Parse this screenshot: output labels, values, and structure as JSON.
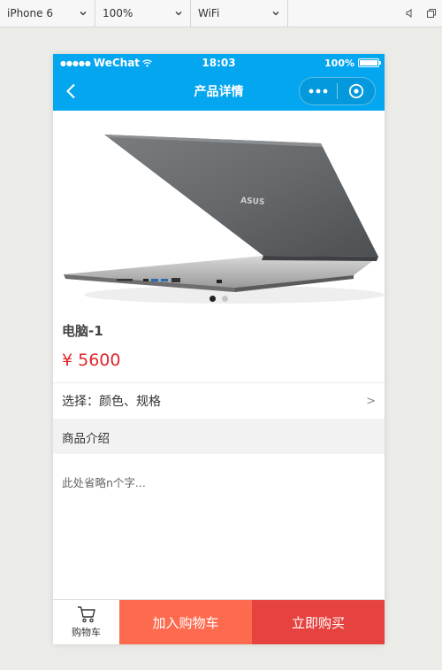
{
  "simulator": {
    "device": "iPhone 6",
    "zoom": "100%",
    "network": "WiFi"
  },
  "status_bar": {
    "carrier": "WeChat",
    "time": "18:03",
    "battery": "100%",
    "battery_level": 1.0
  },
  "nav": {
    "title": "产品详情"
  },
  "carousel": {
    "slide_count": 2,
    "active_index": 0,
    "brand_text": "ASUS"
  },
  "product": {
    "name": "电脑-1",
    "price": "¥ 5600"
  },
  "spec": {
    "label": "选择：颜色、规格",
    "arrow": ">"
  },
  "intro": {
    "header": "商品介绍",
    "text": "此处省略n个字..."
  },
  "bottom_bar": {
    "cart_label": "购物车",
    "add_to_cart": "加入购物车",
    "buy_now": "立即购买"
  },
  "colors": {
    "nav_blue": "#04a6ef",
    "price_red": "#e0252c",
    "add_cart_orange": "#fd6a4e",
    "buy_red": "#e64340"
  }
}
